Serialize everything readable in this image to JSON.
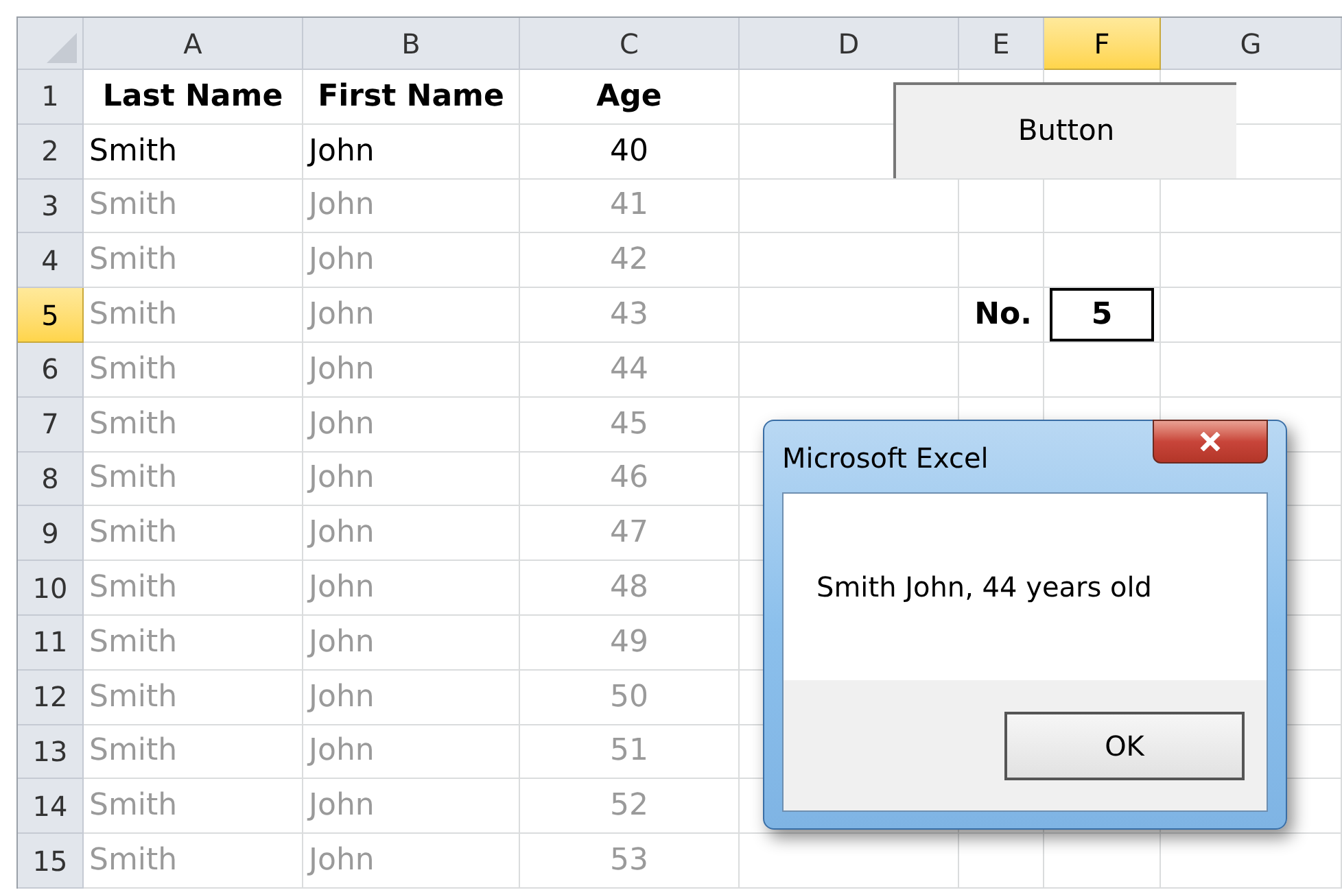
{
  "columns": [
    {
      "label": "A",
      "selected": false
    },
    {
      "label": "B",
      "selected": false
    },
    {
      "label": "C",
      "selected": false
    },
    {
      "label": "D",
      "selected": false
    },
    {
      "label": "E",
      "selected": false
    },
    {
      "label": "F",
      "selected": true
    },
    {
      "label": "G",
      "selected": false
    }
  ],
  "rows": [
    {
      "number": "1",
      "selected": false,
      "kind": "header",
      "cells": [
        "Last Name",
        "First Name",
        "Age"
      ]
    },
    {
      "number": "2",
      "selected": false,
      "kind": "normal",
      "cells": [
        "Smith",
        "John",
        "40"
      ]
    },
    {
      "number": "3",
      "selected": false,
      "kind": "dimmed",
      "cells": [
        "Smith",
        "John",
        "41"
      ]
    },
    {
      "number": "4",
      "selected": false,
      "kind": "dimmed",
      "cells": [
        "Smith",
        "John",
        "42"
      ]
    },
    {
      "number": "5",
      "selected": true,
      "kind": "dimmed",
      "cells": [
        "Smith",
        "John",
        "43"
      ],
      "label": "No.",
      "value": "5",
      "value_selected": true
    },
    {
      "number": "6",
      "selected": false,
      "kind": "dimmed",
      "cells": [
        "Smith",
        "John",
        "44"
      ]
    },
    {
      "number": "7",
      "selected": false,
      "kind": "dimmed",
      "cells": [
        "Smith",
        "John",
        "45"
      ]
    },
    {
      "number": "8",
      "selected": false,
      "kind": "dimmed",
      "cells": [
        "Smith",
        "John",
        "46"
      ]
    },
    {
      "number": "9",
      "selected": false,
      "kind": "dimmed",
      "cells": [
        "Smith",
        "John",
        "47"
      ]
    },
    {
      "number": "10",
      "selected": false,
      "kind": "dimmed",
      "cells": [
        "Smith",
        "John",
        "48"
      ]
    },
    {
      "number": "11",
      "selected": false,
      "kind": "dimmed",
      "cells": [
        "Smith",
        "John",
        "49"
      ]
    },
    {
      "number": "12",
      "selected": false,
      "kind": "dimmed",
      "cells": [
        "Smith",
        "John",
        "50"
      ]
    },
    {
      "number": "13",
      "selected": false,
      "kind": "dimmed",
      "cells": [
        "Smith",
        "John",
        "51"
      ]
    },
    {
      "number": "14",
      "selected": false,
      "kind": "dimmed",
      "cells": [
        "Smith",
        "John",
        "52"
      ]
    },
    {
      "number": "15",
      "selected": false,
      "kind": "dimmed",
      "cells": [
        "Smith",
        "John",
        "53"
      ]
    }
  ],
  "sheet_button": {
    "label": "Button"
  },
  "dialog": {
    "title": "Microsoft Excel",
    "message": "Smith John, 44 years old",
    "button": "OK"
  }
}
